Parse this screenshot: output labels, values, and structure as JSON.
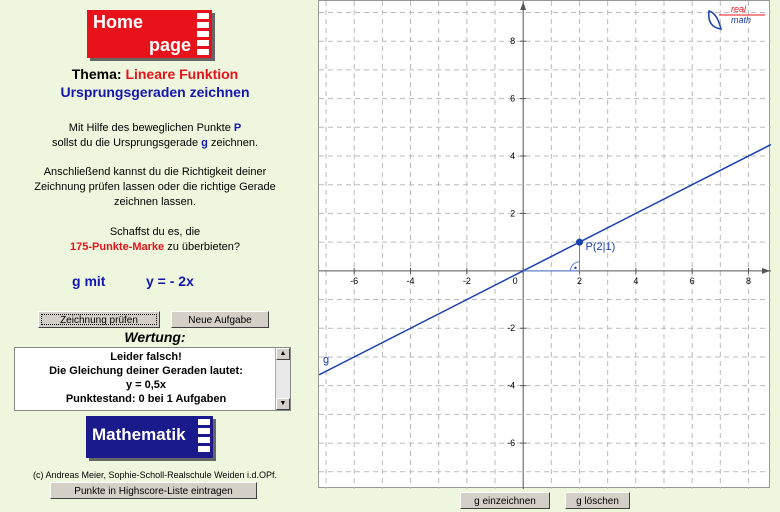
{
  "home": {
    "line1": "Home",
    "line2": "page"
  },
  "topic": {
    "prefix": "Thema: ",
    "name": "Lineare Funktion",
    "subtitle": "Ursprungsgeraden zeichnen"
  },
  "para1": {
    "a": "Mit Hilfe des beweglichen Punkte ",
    "p": "P",
    "b": "sollst du die Ursprungsgerade ",
    "g": "g",
    "c": " zeichnen."
  },
  "para2": {
    "l1": "Anschließend kannst du die Richtigkeit deiner",
    "l2": "Zeichnung prüfen lassen oder die richtige Gerade",
    "l3": "zeichnen lassen."
  },
  "para3": {
    "l1": "Schaffst du es, die",
    "marke": "175-Punkte-Marke",
    "l2": " zu überbieten?"
  },
  "task": {
    "label": "g mit",
    "equation": "y = - 2x"
  },
  "buttons": {
    "check": "Zeichnung prüfen",
    "new": "Neue Aufgabe",
    "highscore": "Punkte in Highscore-Liste eintragen",
    "draw": "g einzeichnen",
    "delete": "g löschen"
  },
  "rating": {
    "title": "Wertung:",
    "l1": "Leider falsch!",
    "l2": "Die Gleichung deiner Geraden lautet:",
    "l3": "y = 0,5x",
    "l4": "Punktestand: 0 bei 1 Aufgaben"
  },
  "math_logo": "Mathematik",
  "copyright": "(c) Andreas Meier, Sophie-Scholl-Realschule Weiden i.d.OPf.",
  "graph": {
    "point_label": "P(2|1)",
    "line_label": "g",
    "brand_top": "real",
    "brand_bottom": "math",
    "x_ticks": [
      -6,
      -4,
      -2,
      0,
      2,
      4,
      6,
      8
    ],
    "y_ticks": [
      8,
      6,
      4,
      2,
      -2,
      -4,
      -6
    ],
    "xlim": [
      -7.25,
      8.8
    ],
    "ylim": [
      -7.6,
      9.4
    ],
    "point": {
      "x": 2,
      "y": 1
    },
    "slope": 0.5,
    "line_color": "#1a3fb0"
  }
}
